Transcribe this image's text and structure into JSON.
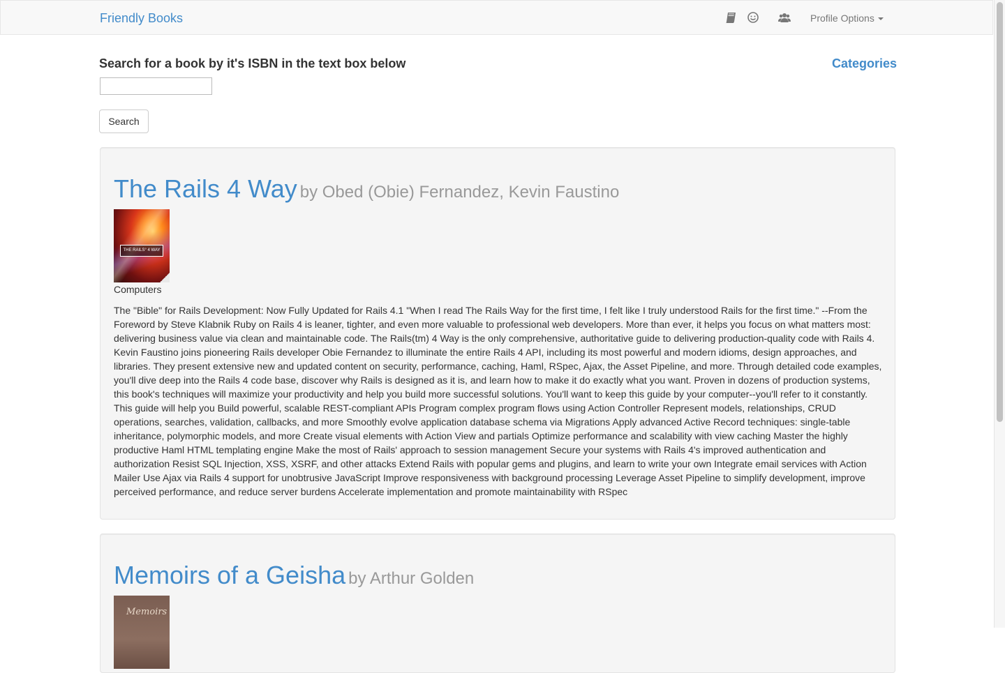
{
  "navbar": {
    "brand": "Friendly Books",
    "icons": [
      "book-icon",
      "smile-icon",
      "users-icon"
    ],
    "profile_label": "Profile Options"
  },
  "search": {
    "heading": "Search for a book by it's ISBN in the text box below",
    "input_value": "",
    "button_label": "Search"
  },
  "categories_link": "Categories",
  "books": [
    {
      "title": "The Rails 4 Way",
      "author": "by Obed (Obie) Fernandez, Kevin Faustino",
      "cover_text": "THE RAILS° 4 WAY",
      "category": "Computers",
      "description": "The \"Bible\" for Rails Development: Now Fully Updated for Rails 4.1 \"When I read The Rails Way for the first time, I felt like I truly understood Rails for the first time.\" --From the Foreword by Steve Klabnik Ruby on Rails 4 is leaner, tighter, and even more valuable to professional web developers. More than ever, it helps you focus on what matters most: delivering business value via clean and maintainable code. The Rails(tm) 4 Way is the only comprehensive, authoritative guide to delivering production-quality code with Rails 4. Kevin Faustino joins pioneering Rails developer Obie Fernandez to illuminate the entire Rails 4 API, including its most powerful and modern idioms, design approaches, and libraries. They present extensive new and updated content on security, performance, caching, Haml, RSpec, Ajax, the Asset Pipeline, and more. Through detailed code examples, you'll dive deep into the Rails 4 code base, discover why Rails is designed as it is, and learn how to make it do exactly what you want. Proven in dozens of production systems, this book's techniques will maximize your productivity and help you build more successful solutions. You'll want to keep this guide by your computer--you'll refer to it constantly. This guide will help you Build powerful, scalable REST-compliant APIs Program complex program flows using Action Controller Represent models, relationships, CRUD operations, searches, validation, callbacks, and more Smoothly evolve application database schema via Migrations Apply advanced Active Record techniques: single-table inheritance, polymorphic models, and more Create visual elements with Action View and partials Optimize performance and scalability with view caching Master the highly productive Haml HTML templating engine Make the most of Rails' approach to session management Secure your systems with Rails 4's improved authentication and authorization Resist SQL Injection, XSS, XSRF, and other attacks Extend Rails with popular gems and plugins, and learn to write your own Integrate email services with Action Mailer Use Ajax via Rails 4 support for unobtrusive JavaScript Improve responsiveness with background processing Leverage Asset Pipeline to simplify development, improve perceived performance, and reduce server burdens Accelerate implementation and promote maintainability with RSpec"
    },
    {
      "title": "Memoirs of a Geisha",
      "author": "by Arthur Golden",
      "cover_text": "Memoirs"
    }
  ],
  "colors": {
    "link": "#428bca",
    "navbar_bg": "#f8f8f8",
    "card_bg": "#f5f5f5",
    "muted": "#999999"
  }
}
